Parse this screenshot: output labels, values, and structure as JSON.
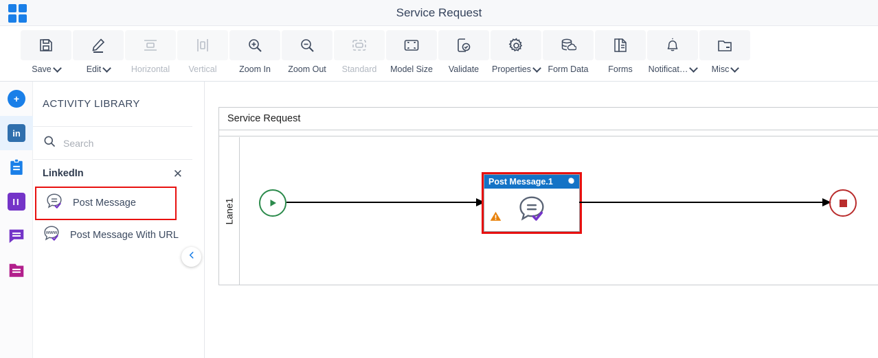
{
  "window": {
    "app_icon": "grid-apps-icon",
    "title": "Service Request"
  },
  "toolbar": {
    "items": [
      {
        "id": "save",
        "label": "Save",
        "icon": "save-floppy-icon",
        "has_caret": true,
        "disabled": false
      },
      {
        "id": "edit",
        "label": "Edit",
        "icon": "pencil-edit-icon",
        "has_caret": true,
        "disabled": false
      },
      {
        "id": "horizontal",
        "label": "Horizontal",
        "icon": "horizontal-align-icon",
        "has_caret": false,
        "disabled": true
      },
      {
        "id": "vertical",
        "label": "Vertical",
        "icon": "vertical-align-icon",
        "has_caret": false,
        "disabled": true
      },
      {
        "id": "zoom-in",
        "label": "Zoom In",
        "icon": "zoom-in-icon",
        "has_caret": false,
        "disabled": false
      },
      {
        "id": "zoom-out",
        "label": "Zoom Out",
        "icon": "zoom-out-icon",
        "has_caret": false,
        "disabled": false
      },
      {
        "id": "standard",
        "label": "Standard",
        "icon": "standard-size-icon",
        "has_caret": false,
        "disabled": true
      },
      {
        "id": "model-size",
        "label": "Model Size",
        "icon": "model-size-icon",
        "has_caret": false,
        "disabled": false
      },
      {
        "id": "validate",
        "label": "Validate",
        "icon": "validate-check-icon",
        "has_caret": false,
        "disabled": false
      },
      {
        "id": "properties",
        "label": "Properties",
        "icon": "gear-icon",
        "has_caret": true,
        "disabled": false
      },
      {
        "id": "form-data",
        "label": "Form Data",
        "icon": "database-icon",
        "has_caret": false,
        "disabled": false
      },
      {
        "id": "forms",
        "label": "Forms",
        "icon": "documents-icon",
        "has_caret": false,
        "disabled": false
      },
      {
        "id": "notifications",
        "label": "Notificat…",
        "icon": "bell-icon",
        "has_caret": true,
        "disabled": false
      },
      {
        "id": "misc",
        "label": "Misc",
        "icon": "folder-icon",
        "has_caret": true,
        "disabled": false
      }
    ]
  },
  "rail": {
    "items": [
      {
        "id": "add",
        "icon": "plus-circle-icon",
        "color": "#1a7fe8",
        "active": false,
        "shape": "circle"
      },
      {
        "id": "linkedin",
        "icon": "linkedin-icon",
        "color": "#2f6fad",
        "active": true,
        "shape": "square"
      },
      {
        "id": "clipboard",
        "icon": "clipboard-icon",
        "color": "#1a7fe8",
        "active": false,
        "shape": "square"
      },
      {
        "id": "columns",
        "icon": "columns-icon",
        "color": "#7434c8",
        "active": false,
        "shape": "square"
      },
      {
        "id": "chat",
        "icon": "chat-bubble-icon",
        "color": "#7434c8",
        "active": false,
        "shape": "square"
      },
      {
        "id": "folder",
        "icon": "folder-lines-icon",
        "color": "#b21f8c",
        "active": false,
        "shape": "square"
      }
    ]
  },
  "library": {
    "title": "ACTIVITY LIBRARY",
    "search": {
      "value": "",
      "placeholder": "Search",
      "icon": "search-icon"
    },
    "group": {
      "name": "LinkedIn",
      "close_icon": "close-x-icon"
    },
    "items": [
      {
        "id": "post-message",
        "label": "Post Message",
        "icon": "linkedin-post-icon",
        "highlighted": true
      },
      {
        "id": "post-message-with-url",
        "label": "Post Message With URL",
        "icon": "linkedin-post-url-icon",
        "highlighted": false
      }
    ],
    "collapse_icon": "chevron-left-icon"
  },
  "canvas": {
    "pool_name": "Service Request",
    "lane_name": "Lane1",
    "nodes": [
      {
        "id": "start",
        "type": "start-event",
        "label": ""
      },
      {
        "id": "post-message-1",
        "type": "task",
        "label": "Post Message.1",
        "gear_icon": "gear-icon",
        "warning_icon": "warning-triangle-icon",
        "glyph_icon": "linkedin-post-icon",
        "selected": true
      },
      {
        "id": "end",
        "type": "end-event",
        "label": ""
      }
    ]
  },
  "colors": {
    "accent": "#1a7fe8",
    "selection": "#e8100f",
    "task_header": "#1473c6",
    "start_event": "#2b8a4b",
    "end_event": "#b92c2c",
    "warning": "#e8820c",
    "check": "#7434c8"
  }
}
